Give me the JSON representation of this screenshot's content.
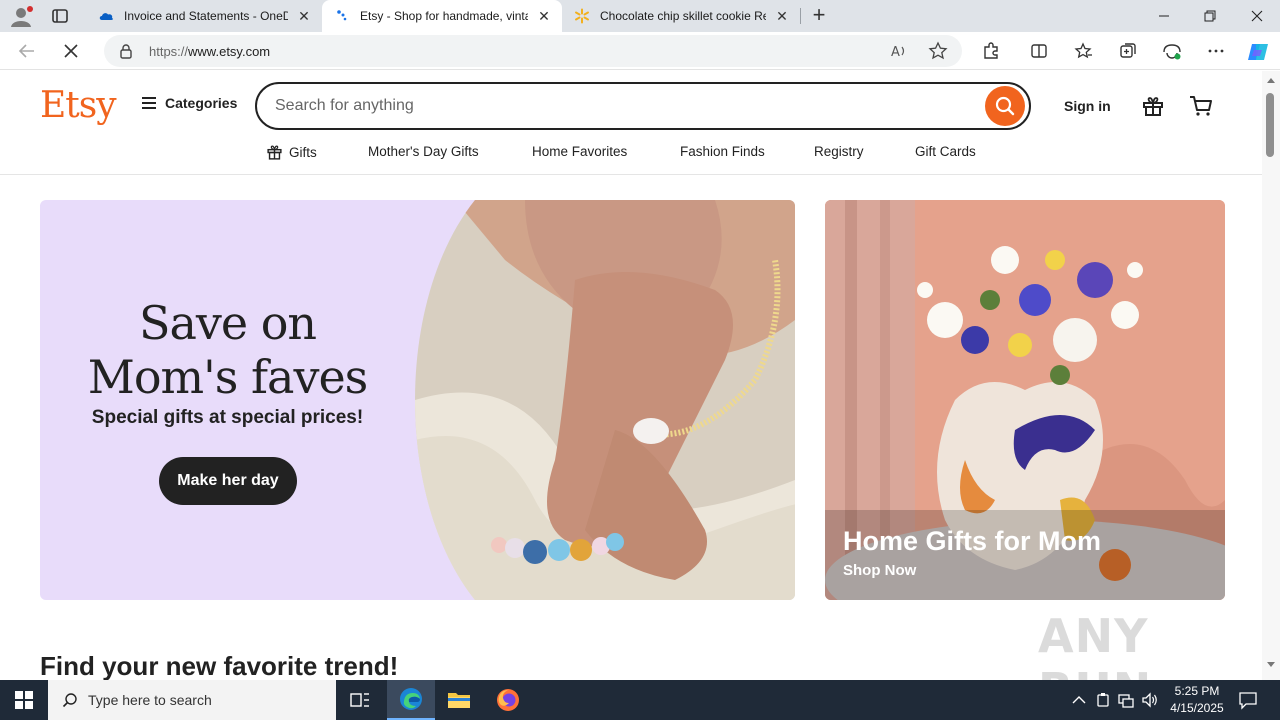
{
  "browser": {
    "tabs": [
      {
        "title": "Invoice and Statements - OneDrive",
        "favicon": "onedrive-cloud-icon"
      },
      {
        "title": "Etsy - Shop for handmade, vintage, custom, and unique gifts",
        "favicon": "etsy-loading-icon",
        "active": true
      },
      {
        "title": "Chocolate chip skillet cookie Recipe",
        "favicon": "walmart-spark-icon"
      }
    ],
    "url_protocol": "https://",
    "url_host": "www.etsy.com"
  },
  "etsy": {
    "logo": "Etsy",
    "categories_label": "Categories",
    "search_placeholder": "Search for anything",
    "signin_label": "Sign in",
    "nav": [
      "Gifts",
      "Mother's Day Gifts",
      "Home Favorites",
      "Fashion Finds",
      "Registry",
      "Gift Cards"
    ],
    "hero": {
      "title_line1": "Save on",
      "title_line2": "Mom's faves",
      "subtitle": "Special gifts at special prices!",
      "cta": "Make her day"
    },
    "promo": {
      "title": "Home Gifts for Mom",
      "link": "Shop Now"
    },
    "section_title": "Find your new favorite trend!",
    "brand_color": "#f1641e"
  },
  "watermark": "ANY RUN",
  "taskbar": {
    "search_placeholder": "Type here to search",
    "time": "5:25 PM",
    "date": "4/15/2025"
  }
}
